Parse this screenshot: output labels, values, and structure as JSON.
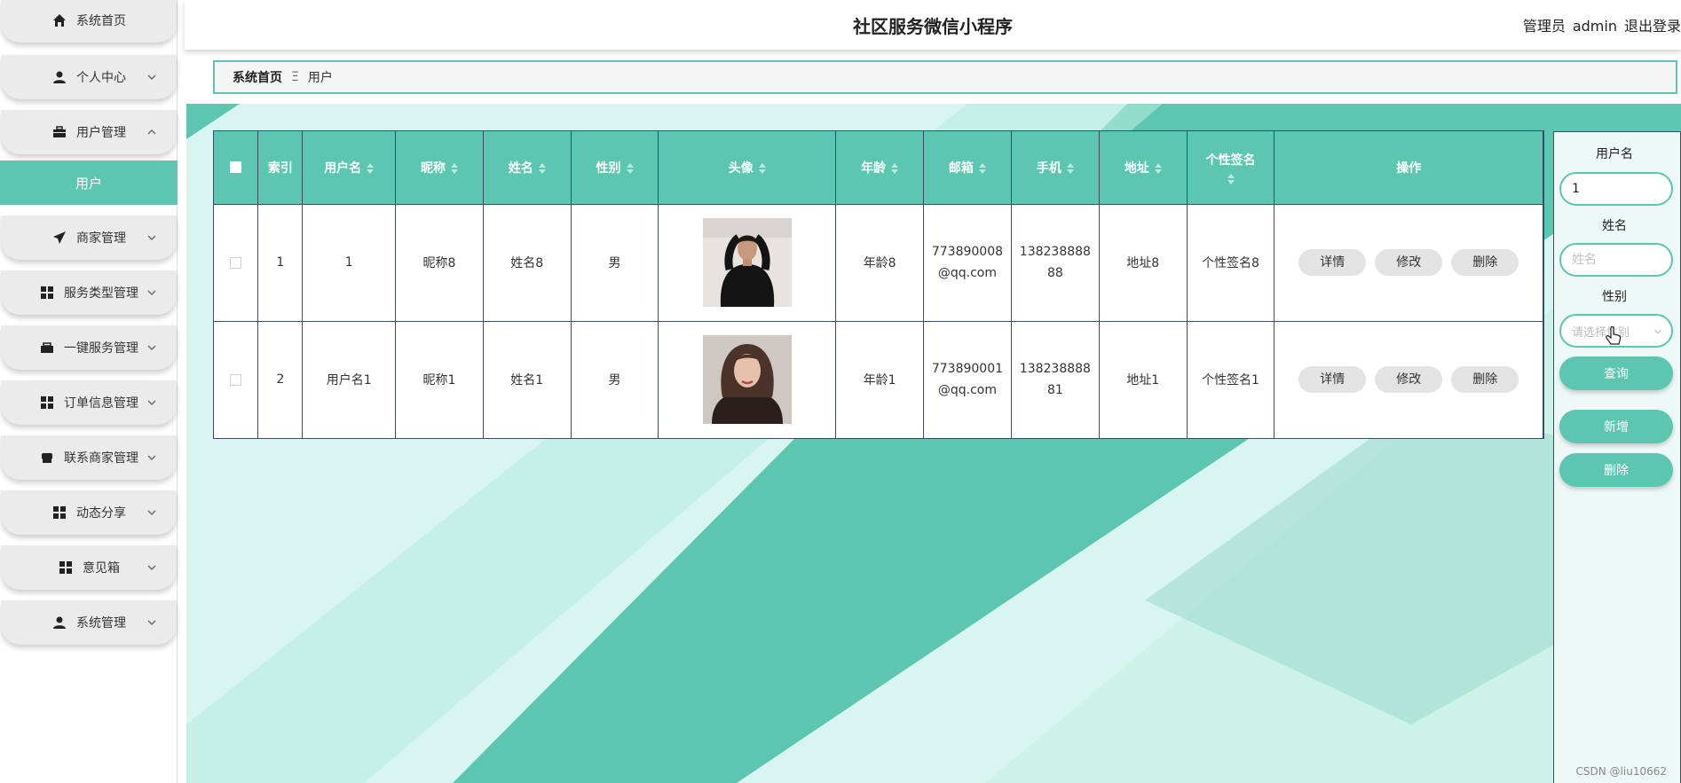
{
  "sidebar": {
    "items": [
      {
        "label": "系统首页",
        "icon": "home-icon"
      },
      {
        "label": "个人中心",
        "icon": "user-icon"
      },
      {
        "label": "用户管理",
        "icon": "briefcase-icon"
      },
      {
        "label": "商家管理",
        "icon": "send-icon"
      },
      {
        "label": "服务类型管理",
        "icon": "grid-icon"
      },
      {
        "label": "一键服务管理",
        "icon": "toolbox-icon"
      },
      {
        "label": "订单信息管理",
        "icon": "grid-icon"
      },
      {
        "label": "联系商家管理",
        "icon": "store-icon"
      },
      {
        "label": "动态分享",
        "icon": "grid-icon"
      },
      {
        "label": "意见箱",
        "icon": "grid-icon"
      },
      {
        "label": "系统管理",
        "icon": "user-icon"
      }
    ],
    "active_sub": "用户"
  },
  "header": {
    "title": "社区服务微信小程序",
    "user_role": "管理员",
    "username": "admin",
    "logout": "退出登录"
  },
  "breadcrumb": {
    "home": "系统首页",
    "separator": "Ξ",
    "current": "用户"
  },
  "table": {
    "headers": {
      "index": "索引",
      "username": "用户名",
      "nickname": "昵称",
      "name": "姓名",
      "gender": "性别",
      "avatar": "头像",
      "age": "年龄",
      "email": "邮箱",
      "phone": "手机",
      "address": "地址",
      "signature": "个性签名",
      "actions": "操作"
    },
    "rows": [
      {
        "index": "1",
        "username": "1",
        "nickname": "昵称8",
        "name": "姓名8",
        "gender": "男",
        "age": "年龄8",
        "email_1": "773890008",
        "email_2": "@qq.com",
        "phone_1": "138238888",
        "phone_2": "88",
        "address": "地址8",
        "signature": "个性签名8"
      },
      {
        "index": "2",
        "username": "用户名1",
        "nickname": "昵称1",
        "name": "姓名1",
        "gender": "男",
        "age": "年龄1",
        "email_1": "773890001",
        "email_2": "@qq.com",
        "phone_1": "138238888",
        "phone_2": "81",
        "address": "地址1",
        "signature": "个性签名1"
      }
    ],
    "actions": {
      "detail": "详情",
      "edit": "修改",
      "delete": "删除"
    }
  },
  "search": {
    "username_label": "用户名",
    "username_value": "1",
    "name_label": "姓名",
    "name_placeholder": "姓名",
    "gender_label": "性别",
    "gender_placeholder": "请选择性别",
    "query_button": "查询",
    "add_button": "新增",
    "delete_button": "删除"
  },
  "watermark": "CSDN @liu10662",
  "colors": {
    "accent": "#5cc6b0",
    "accent_dark": "#4ab39d",
    "bg_light": "#c8f0e6"
  }
}
